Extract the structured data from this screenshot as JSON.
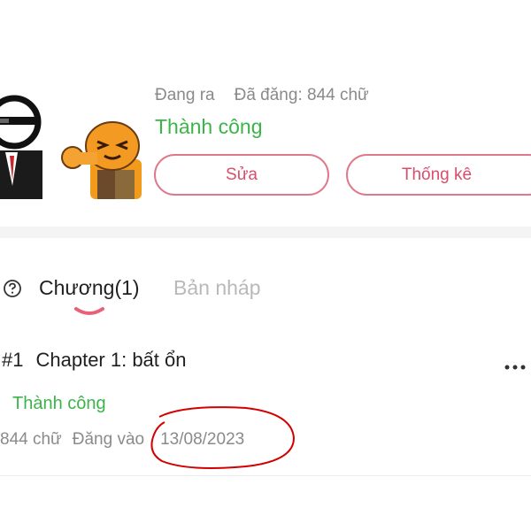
{
  "story": {
    "status_label": "Đang ra",
    "posted_label": "Đã đăng: 844 chữ",
    "result": "Thành công",
    "edit_label": "Sửa",
    "stats_label": "Thống kê"
  },
  "tabs": [
    {
      "label": "Chương(1)",
      "active": true
    },
    {
      "label": "Bản nháp",
      "active": false
    }
  ],
  "chapters": [
    {
      "number": "#1",
      "title": "Chapter 1: bất ổn",
      "status": "Thành công",
      "word_count": "844 chữ",
      "posted_label": "Đăng vào",
      "date": "13/08/2023"
    }
  ],
  "colors": {
    "success": "#3bb54a",
    "accent": "#d94e6a",
    "annotation": "#d40000"
  },
  "icons": [
    "help-circle-icon",
    "more-horizontal-icon"
  ]
}
